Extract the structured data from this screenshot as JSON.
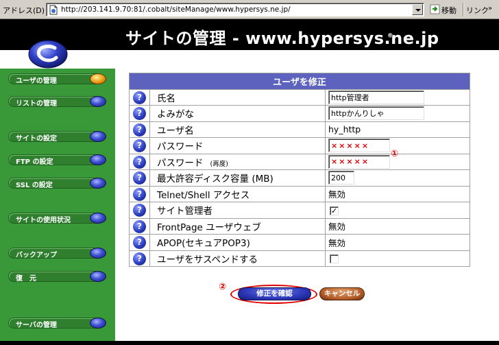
{
  "address_bar": {
    "label": "アドレス(D)",
    "url": "http://203.141.9.70:81/.cobalt/siteManage/www.hypersys.ne.jp/",
    "go_label": "移動",
    "links_label": "リンク",
    "links_chevron": "»"
  },
  "header": {
    "title": "サイトの管理 - www.hypersys.ne.jp"
  },
  "sidebar": {
    "items": [
      {
        "label": "ユーザの管理",
        "active": true
      },
      {
        "label": "リストの管理",
        "active": false
      },
      {
        "label": "サイトの設定",
        "active": false
      },
      {
        "label": "FTP の設定",
        "active": false
      },
      {
        "label": "SSL の設定",
        "active": false
      },
      {
        "label": "サイトの使用状況",
        "active": false
      },
      {
        "label": "バックアップ",
        "active": false
      },
      {
        "label": "復　元",
        "active": false
      },
      {
        "label": "サーバの管理",
        "active": false
      }
    ]
  },
  "form": {
    "caption": "ユーザを修正",
    "help_glyph": "?",
    "rows": [
      {
        "label": "氏名",
        "value": "http管理者"
      },
      {
        "label": "よみがな",
        "value": "httpかんりしゃ"
      },
      {
        "label": "ユーザ名",
        "value": "hy_http"
      },
      {
        "label": "パスワード",
        "value": "×××××"
      },
      {
        "label": "パスワード",
        "note": "(再度)",
        "value": "×××××"
      },
      {
        "label": "最大許容ディスク容量 (MB)",
        "value": "200"
      },
      {
        "label": "Telnet/Shell アクセス",
        "value": "無効"
      },
      {
        "label": "サイト管理者",
        "checked": true
      },
      {
        "label": "FrontPage ユーザウェブ",
        "value": "無効"
      },
      {
        "label": "APOP(セキュアPOP3)",
        "value": "無効"
      },
      {
        "label": "ユーザをサスペンドする",
        "checked": false
      }
    ]
  },
  "annotations": {
    "marker1": "①",
    "marker2": "②"
  },
  "buttons": {
    "confirm": "修正を確認",
    "cancel": "キャンセル"
  },
  "checkbox_glyph": "✓",
  "colors": {
    "header_bg": "#000000",
    "sidebar_bg": "#399939",
    "caption_bg": "#5c62bd",
    "marker_red": "#e00000",
    "active_orb": "#f0a820"
  }
}
